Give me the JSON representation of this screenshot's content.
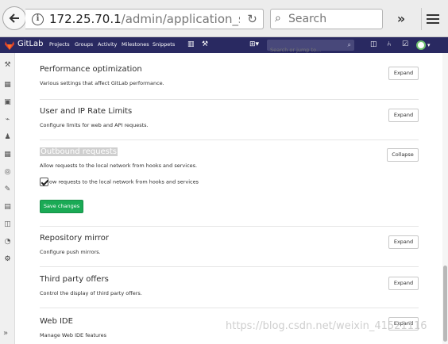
{
  "browser": {
    "url_host": "172.25.70.1",
    "url_path": "/admin/application_settir",
    "search_placeholder": "Search"
  },
  "gitlab_nav": {
    "brand": "GitLab",
    "links": [
      "Projects",
      "Groups",
      "Activity",
      "Milestones",
      "Snippets"
    ],
    "search_placeholder": "Search or jump to..."
  },
  "sections": [
    {
      "title": "Performance optimization",
      "desc": "Various settings that affect GitLab performance.",
      "button": "Expand"
    },
    {
      "title": "User and IP Rate Limits",
      "desc": "Configure limits for web and API requests.",
      "button": "Expand"
    },
    {
      "title": "Outbound requests",
      "desc": "Allow requests to the local network from hooks and services.",
      "button": "Collapse",
      "checkbox_label": "ow requests to the local network from hooks and services",
      "checkbox_checked": true,
      "save_label": "Save changes"
    },
    {
      "title": "Repository mirror",
      "desc": "Configure push mirrors.",
      "button": "Expand"
    },
    {
      "title": "Third party offers",
      "desc": "Control the display of third party offers.",
      "button": "Expand"
    },
    {
      "title": "Web IDE",
      "desc": "Manage Web IDE features",
      "button": "Expand"
    }
  ],
  "watermark": "https://blog.csdn.net/weixin_41521116",
  "colors": {
    "navbar": "#292961",
    "save_button": "#1aaa55",
    "logo": "#e24329"
  }
}
